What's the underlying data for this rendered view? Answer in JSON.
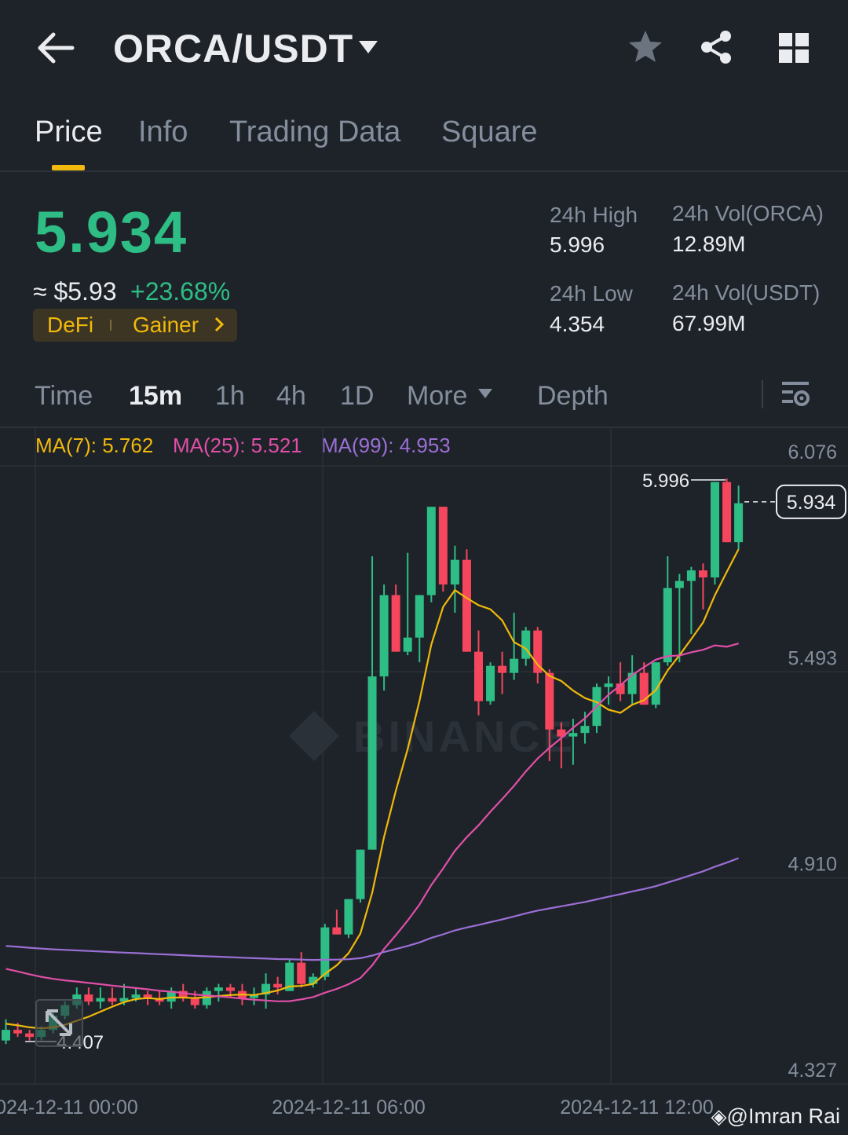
{
  "header": {
    "pair": "ORCA/USDT",
    "back_icon": "arrow-left-icon",
    "dropdown_icon": "caret-down-icon",
    "actions": [
      "star-icon",
      "share-icon",
      "grid-icon"
    ]
  },
  "tabs": [
    {
      "label": "Price",
      "active": true
    },
    {
      "label": "Info",
      "active": false
    },
    {
      "label": "Trading Data",
      "active": false
    },
    {
      "label": "Square",
      "active": false
    }
  ],
  "ticker": {
    "last_price": "5.934",
    "usd_approx": "≈ $5.93",
    "change": "+23.68%",
    "tags": [
      "DeFi",
      "Gainer"
    ],
    "stats": {
      "high_label": "24h High",
      "high_value": "5.996",
      "low_label": "24h Low",
      "low_value": "4.354",
      "vol_base_label": "24h Vol(ORCA)",
      "vol_base_value": "12.89M",
      "vol_quote_label": "24h Vol(USDT)",
      "vol_quote_value": "67.99M"
    }
  },
  "intervals": {
    "items": [
      "Time",
      "15m",
      "1h",
      "4h",
      "1D",
      "More",
      "Depth"
    ],
    "active": "15m"
  },
  "indicators": {
    "ma7": "MA(7): 5.762",
    "ma25": "MA(25): 5.521",
    "ma99": "MA(99): 4.953"
  },
  "colors": {
    "up": "#2ebd85",
    "down": "#f6465d",
    "accent": "#f0b90b",
    "ma7": "#f0b90b",
    "ma25": "#e04fa8",
    "ma99": "#9b6fd6",
    "background": "#1e2329"
  },
  "chart_data": {
    "type": "candlestick",
    "y_axis_ticks": [
      "6.076",
      "5.493",
      "4.910",
      "4.327"
    ],
    "ylim": [
      4.327,
      6.076
    ],
    "x_axis_ticks": [
      "2024-12-11 00:00",
      "2024-12-11 06:00",
      "2024-12-11 12:00"
    ],
    "high_marker": "5.996",
    "low_marker": "4.407",
    "current_price_label": "5.934",
    "candles": [
      [
        4.41,
        4.47,
        4.4,
        4.44
      ],
      [
        4.44,
        4.46,
        4.42,
        4.43
      ],
      [
        4.43,
        4.44,
        4.41,
        4.42
      ],
      [
        4.42,
        4.45,
        4.41,
        4.44
      ],
      [
        4.44,
        4.49,
        4.43,
        4.48
      ],
      [
        4.48,
        4.52,
        4.47,
        4.51
      ],
      [
        4.51,
        4.56,
        4.5,
        4.54
      ],
      [
        4.54,
        4.56,
        4.51,
        4.52
      ],
      [
        4.52,
        4.56,
        4.5,
        4.53
      ],
      [
        4.53,
        4.56,
        4.51,
        4.52
      ],
      [
        4.52,
        4.57,
        4.51,
        4.53
      ],
      [
        4.53,
        4.56,
        4.52,
        4.54
      ],
      [
        4.54,
        4.55,
        4.51,
        4.53
      ],
      [
        4.53,
        4.55,
        4.51,
        4.52
      ],
      [
        4.52,
        4.56,
        4.5,
        4.55
      ],
      [
        4.55,
        4.57,
        4.52,
        4.53
      ],
      [
        4.53,
        4.55,
        4.5,
        4.51
      ],
      [
        4.51,
        4.56,
        4.5,
        4.55
      ],
      [
        4.55,
        4.57,
        4.52,
        4.56
      ],
      [
        4.56,
        4.57,
        4.53,
        4.55
      ],
      [
        4.55,
        4.57,
        4.51,
        4.53
      ],
      [
        4.53,
        4.56,
        4.51,
        4.54
      ],
      [
        4.54,
        4.6,
        4.5,
        4.57
      ],
      [
        4.57,
        4.59,
        4.54,
        4.56
      ],
      [
        4.55,
        4.64,
        4.55,
        4.63
      ],
      [
        4.63,
        4.66,
        4.56,
        4.57
      ],
      [
        4.57,
        4.6,
        4.56,
        4.59
      ],
      [
        4.59,
        4.74,
        4.58,
        4.73
      ],
      [
        4.73,
        4.78,
        4.71,
        4.71
      ],
      [
        4.71,
        4.81,
        4.7,
        4.81
      ],
      [
        4.81,
        4.95,
        4.8,
        4.95
      ],
      [
        4.95,
        5.78,
        4.95,
        5.44
      ],
      [
        5.44,
        5.7,
        5.4,
        5.67
      ],
      [
        5.67,
        5.7,
        5.51,
        5.51
      ],
      [
        5.51,
        5.79,
        5.5,
        5.55
      ],
      [
        5.55,
        5.67,
        5.48,
        5.67
      ],
      [
        5.67,
        5.92,
        5.65,
        5.92
      ],
      [
        5.92,
        5.88,
        5.68,
        5.7
      ],
      [
        5.7,
        5.81,
        5.62,
        5.77
      ],
      [
        5.77,
        5.8,
        5.52,
        5.51
      ],
      [
        5.51,
        5.57,
        5.33,
        5.37
      ],
      [
        5.37,
        5.48,
        5.36,
        5.47
      ],
      [
        5.47,
        5.51,
        5.39,
        5.45
      ],
      [
        5.45,
        5.62,
        5.43,
        5.49
      ],
      [
        5.49,
        5.58,
        5.47,
        5.57
      ],
      [
        5.57,
        5.58,
        5.42,
        5.45
      ],
      [
        5.45,
        5.46,
        5.2,
        5.29
      ],
      [
        5.29,
        5.31,
        5.18,
        5.27
      ],
      [
        5.27,
        5.32,
        5.19,
        5.28
      ],
      [
        5.28,
        5.34,
        5.25,
        5.3
      ],
      [
        5.3,
        5.42,
        5.28,
        5.41
      ],
      [
        5.41,
        5.44,
        5.36,
        5.42
      ],
      [
        5.42,
        5.48,
        5.37,
        5.39
      ],
      [
        5.39,
        5.5,
        5.36,
        5.45
      ],
      [
        5.45,
        5.48,
        5.39,
        5.36
      ],
      [
        5.36,
        5.48,
        5.35,
        5.48
      ],
      [
        5.48,
        5.78,
        5.47,
        5.69
      ],
      [
        5.69,
        5.73,
        5.48,
        5.71
      ],
      [
        5.71,
        5.75,
        5.56,
        5.74
      ],
      [
        5.74,
        5.76,
        5.63,
        5.72
      ],
      [
        5.72,
        5.99,
        5.7,
        5.99
      ],
      [
        5.99,
        6.0,
        5.82,
        5.82
      ],
      [
        5.82,
        5.98,
        5.8,
        5.93
      ]
    ]
  },
  "footer": {
    "credit": "@Imran Rai"
  }
}
